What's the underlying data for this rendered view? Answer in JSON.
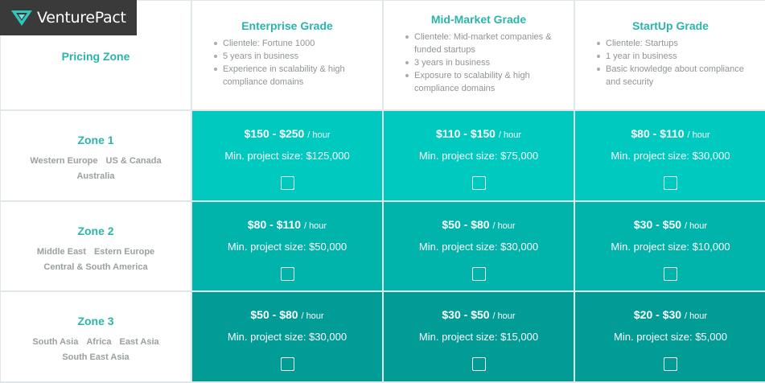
{
  "logo": {
    "text": "VenturePact"
  },
  "corner": {
    "label": "Pricing Zone"
  },
  "grades": [
    {
      "title": "Enterprise Grade",
      "bullets": [
        "Clientele: Fortune 1000",
        "5 years in business",
        "Experience in scalability & high compliance domains"
      ]
    },
    {
      "title": "Mid-Market Grade",
      "bullets": [
        "Clientele: Mid-market companies & funded startups",
        "3 years in business",
        "Exposure to scalability & high compliance domains"
      ]
    },
    {
      "title": "StartUp Grade",
      "bullets": [
        "Clientele: Startups",
        "1 year in business",
        "Basic knowledge about compliance and security"
      ]
    }
  ],
  "zones": [
    {
      "title": "Zone 1",
      "regions": [
        [
          "Western Europe",
          "US & Canada"
        ],
        [
          "Australia"
        ]
      ],
      "prices": [
        {
          "rate": "$150 - $250",
          "unit": "/ hour",
          "min": "Min. project size: $125,000"
        },
        {
          "rate": "$110 - $150",
          "unit": "/ hour",
          "min": "Min. project size: $75,000"
        },
        {
          "rate": "$80 - $110",
          "unit": "/ hour",
          "min": "Min. project size: $30,000"
        }
      ]
    },
    {
      "title": "Zone 2",
      "regions": [
        [
          "Middle East",
          "Estern Europe"
        ],
        [
          "Central & South America"
        ]
      ],
      "prices": [
        {
          "rate": "$80 - $110",
          "unit": "/ hour",
          "min": "Min. project size: $50,000"
        },
        {
          "rate": "$50 - $80",
          "unit": "/ hour",
          "min": "Min. project size: $30,000"
        },
        {
          "rate": "$30 - $50",
          "unit": "/ hour",
          "min": "Min. project size: $10,000"
        }
      ]
    },
    {
      "title": "Zone 3",
      "regions": [
        [
          "South Asia",
          "Africa",
          "East Asia"
        ],
        [
          "South East Asia"
        ]
      ],
      "prices": [
        {
          "rate": "$50 - $80",
          "unit": "/ hour",
          "min": "Min. project size: $30,000"
        },
        {
          "rate": "$30 - $50",
          "unit": "/ hour",
          "min": "Min. project size: $15,000"
        },
        {
          "rate": "$20 - $30",
          "unit": "/ hour",
          "min": "Min. project size: $5,000"
        }
      ]
    }
  ],
  "colors": {
    "accent": "#2ab5ac",
    "zone1": "#00c9bf",
    "zone2": "#00b4ab",
    "zone3": "#009c95"
  }
}
